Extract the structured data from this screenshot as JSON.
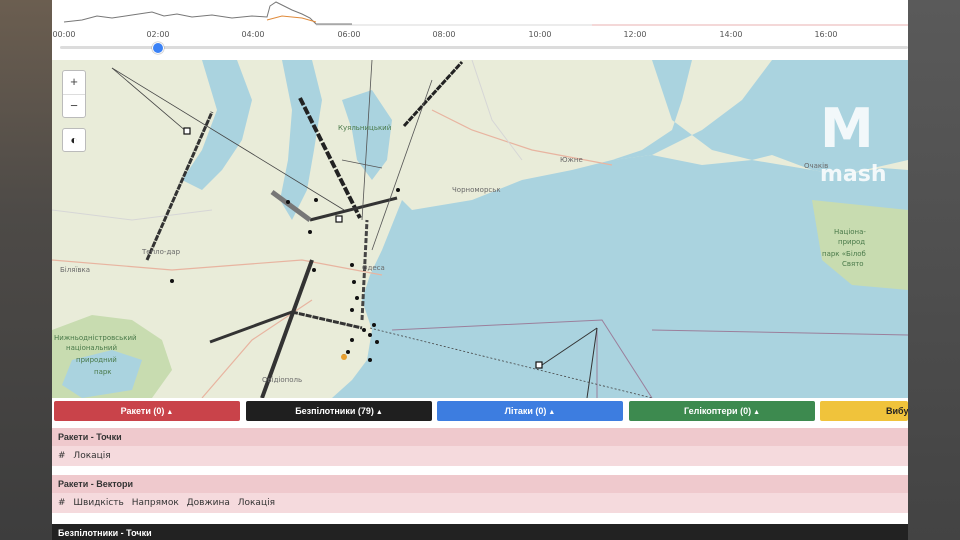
{
  "timeline": {
    "ticks": [
      "00:00",
      "02:00",
      "04:00",
      "06:00",
      "08:00",
      "10:00",
      "12:00",
      "14:00",
      "16:00"
    ]
  },
  "map": {
    "zoom_in": "+",
    "zoom_out": "−",
    "contrast_icon": "◐",
    "places": {
      "teplodar": "Тепло-дар",
      "bilyaivka": "Біляївка",
      "dniester_park1": "Нижньодністровський",
      "dniester_park2": "національний",
      "dniester_park3": "природний",
      "dniester_park4": "парк",
      "chornomorsk": "Чорноморськ",
      "yuzhne": "Южне",
      "ochakiv": "Очаків",
      "odesa": "Одеса",
      "ovidiopol": "Овідіополь",
      "biloberezhzhya1": "Націона-",
      "biloberezhzhya2": "природ",
      "biloberezhzhya3": "парк «Білоб",
      "biloberezhzhya4": "Свято",
      "kuyalnyk": "Куяльницький"
    },
    "watermark": {
      "logo": "M",
      "text": "mash"
    },
    "colors": {
      "water": "#aad3df",
      "land": "#eceed8",
      "park": "#c8dcb0",
      "track": "#222222"
    }
  },
  "categories": [
    {
      "label": "Ракети (0)",
      "color": "#c9434a"
    },
    {
      "label": "Безпілотники (79)",
      "color": "#1f1f1f"
    },
    {
      "label": "Літаки (0)",
      "color": "#3d7de0"
    },
    {
      "label": "Гелікоптери (0)",
      "color": "#3d8a4f"
    },
    {
      "label": "Вибу",
      "color": "#f0c33b"
    }
  ],
  "caret": "▲",
  "tables": {
    "rockets_points": {
      "title": "Ракети - Точки",
      "cols": [
        "#",
        "Локація"
      ]
    },
    "rockets_vectors": {
      "title": "Ракети - Вектори",
      "cols": [
        "#",
        "Швидкість",
        "Напрямок",
        "Довжина",
        "Локація"
      ]
    },
    "drones_points": {
      "title": "Безпілотники - Точки"
    }
  }
}
